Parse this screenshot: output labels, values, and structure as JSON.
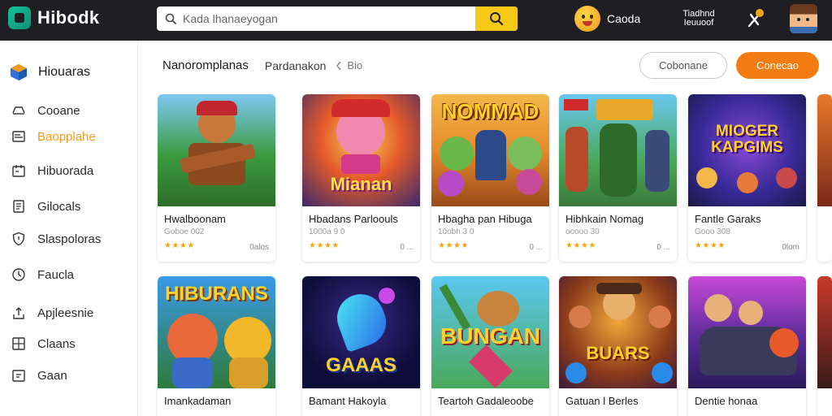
{
  "app": {
    "logo_text": "Hibodk"
  },
  "search": {
    "placeholder": "Kada lhanaeyogan"
  },
  "profile": {
    "name": "Caoda"
  },
  "promo": {
    "line1": "Tiadhnd",
    "line2": "Ieuuoof"
  },
  "colors": {
    "accent": "#f57c10",
    "topbar": "#1f1f23",
    "search_button": "#f6c915",
    "active_item": "#f29a1c",
    "stars": "#f2a516"
  },
  "sidebar": {
    "header": {
      "label": "Hiouaras",
      "icon": "cube-icon"
    },
    "items": [
      {
        "label": "Cooane",
        "icon": "controller-icon",
        "active": false
      },
      {
        "label": "Baopplahe",
        "icon": "window-icon",
        "active": true
      },
      {
        "label": "Hibuorada",
        "icon": "calendar-icon",
        "active": false
      },
      {
        "label": "Gilocals",
        "icon": "document-icon",
        "active": false
      },
      {
        "label": "Slaspoloras",
        "icon": "shield-icon",
        "active": false
      },
      {
        "label": "Faucla",
        "icon": "clock-icon",
        "active": false
      },
      {
        "label": "Apjleesnie",
        "icon": "upload-icon",
        "active": false
      },
      {
        "label": "Claans",
        "icon": "grid-icon",
        "active": false
      },
      {
        "label": "Gaan",
        "icon": "download-icon",
        "active": false
      }
    ]
  },
  "breadcrumb": {
    "main": "Nanoromplanas",
    "sub": "Pardanakon",
    "last": "Bio"
  },
  "buttons": {
    "secondary": "Cobonane",
    "primary": "Conecao"
  },
  "cards_row1": [
    {
      "title": "Hwalboonam",
      "meta": "Goboe 002",
      "stars": "★★★★",
      "count": "0alos",
      "art_title": ""
    },
    {
      "title": "Hbadans Parloouls",
      "meta": "1000a 9 0",
      "stars": "★★★★",
      "count": "0 ...",
      "art_title": "Mianan"
    },
    {
      "title": "Hbagha pan Hibuga",
      "meta": "10obh 3 0",
      "stars": "★★★★",
      "count": "0 ...",
      "art_title": "NOMMAD"
    },
    {
      "title": "Hibhkain Nomag",
      "meta": "ooooo 30",
      "stars": "★★★★",
      "count": "0 ...",
      "art_title": ""
    },
    {
      "title": "Fantle Garaks",
      "meta": "Gooo 308",
      "stars": "★★★★",
      "count": "0lom",
      "art_title": "MIOGER KAPGIMS"
    }
  ],
  "cards_row2": [
    {
      "title": "Imankadaman",
      "art_title": "HIBURANS"
    },
    {
      "title": "Bamant Hakoyla",
      "art_title": "GAAAS"
    },
    {
      "title": "Teartoh Gadaleoobe",
      "art_title": "BUNGAN"
    },
    {
      "title": "Gatuan l Berles",
      "art_title": "BUARS"
    },
    {
      "title": "Dentie honaa",
      "art_title": ""
    }
  ]
}
